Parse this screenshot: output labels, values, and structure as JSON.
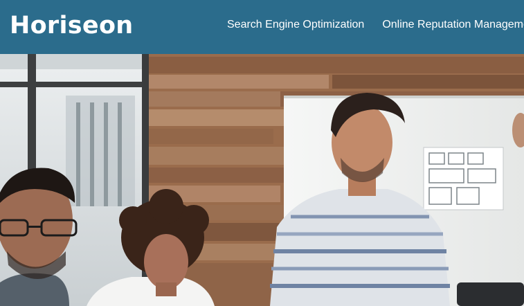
{
  "header": {
    "logo_text": "Horiseon",
    "nav_items": [
      {
        "label": "Search Engine Optimization"
      },
      {
        "label": "Online Reputation Management"
      }
    ]
  },
  "hero": {
    "image_description_icon": "hero-photo",
    "colors": {
      "header_bg": "#2b6c8c",
      "wood": "#a0714f",
      "whiteboard": "#f2f3f1",
      "window_frame": "#3d3f40"
    }
  }
}
